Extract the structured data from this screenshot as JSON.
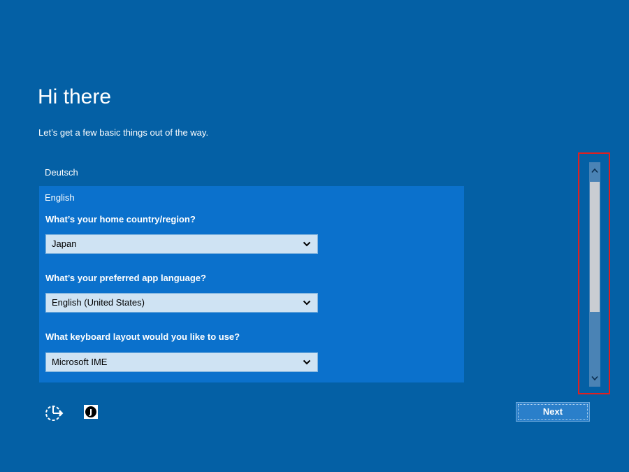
{
  "header": {
    "title": "Hi there",
    "subtitle": "Let’s get a few basic things out of the way."
  },
  "languages": {
    "items": [
      {
        "label": "Deutsch",
        "selected": false
      },
      {
        "label": "English",
        "selected": true
      }
    ]
  },
  "form": {
    "country": {
      "question": "What’s your home country/region?",
      "value": "Japan"
    },
    "app_language": {
      "question": "What’s your preferred app language?",
      "value": "English (United States)"
    },
    "keyboard": {
      "question": "What keyboard layout would you like to use?",
      "value": "Microsoft IME"
    }
  },
  "footer": {
    "next_label": "Next",
    "ime_glyph": "J",
    "ease_of_access_icon": "ease-of-access-icon",
    "ime_icon": "ime-japanese-icon"
  },
  "colors": {
    "background": "#0460a5",
    "selected_panel": "#0b71cc",
    "dropdown": "#cfe3f3",
    "highlight_border": "#e02020"
  }
}
